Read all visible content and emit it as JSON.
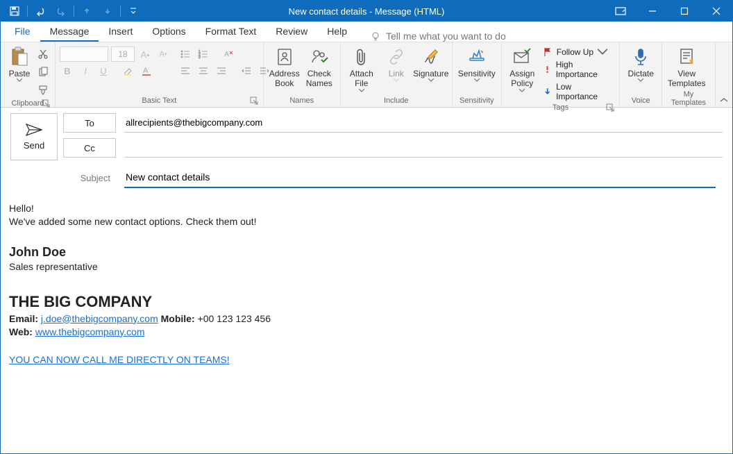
{
  "window_title": "New contact details  -  Message (HTML)",
  "menu": {
    "file": "File",
    "message": "Message",
    "insert": "Insert",
    "options": "Options",
    "format": "Format Text",
    "review": "Review",
    "help": "Help",
    "tell_me": "Tell me what you want to do"
  },
  "ribbon": {
    "clipboard": {
      "label": "Clipboard",
      "paste": "Paste"
    },
    "basic": {
      "label": "Basic Text",
      "font_name": "",
      "font_size": "18"
    },
    "names": {
      "label": "Names",
      "address_book": "Address Book",
      "check_names": "Check Names"
    },
    "include": {
      "label": "Include",
      "attach_file": "Attach File",
      "link": "Link",
      "signature": "Signature"
    },
    "sensitivity": {
      "label": "Sensitivity",
      "btn": "Sensitivity"
    },
    "tags": {
      "label": "Tags",
      "assign": "Assign Policy",
      "follow_up": "Follow Up",
      "high": "High Importance",
      "low": "Low Importance"
    },
    "voice": {
      "label": "Voice",
      "dictate": "Dictate"
    },
    "templates": {
      "label": "My Templates",
      "view": "View Templates"
    }
  },
  "compose": {
    "send": "Send",
    "to_btn": "To",
    "cc_btn": "Cc",
    "to_value": "allrecipients@thebigcompany.com",
    "cc_value": "",
    "subject_label": "Subject",
    "subject_value": "New contact details"
  },
  "body": {
    "hello": "Hello!",
    "intro": "We've added some new contact options. Check them out!",
    "name": "John Doe",
    "role": "Sales representative",
    "company": "THE BIG COMPANY",
    "email_label": "Email: ",
    "email": "j.doe@thebigcompany.com",
    "mobile_label": " Mobile: ",
    "mobile": "+00 123 123 456",
    "web_label": "Web: ",
    "web": "www.thebigcompany.com",
    "teams": "YOU CAN NOW CALL ME DIRECTLY ON TEAMS!"
  }
}
